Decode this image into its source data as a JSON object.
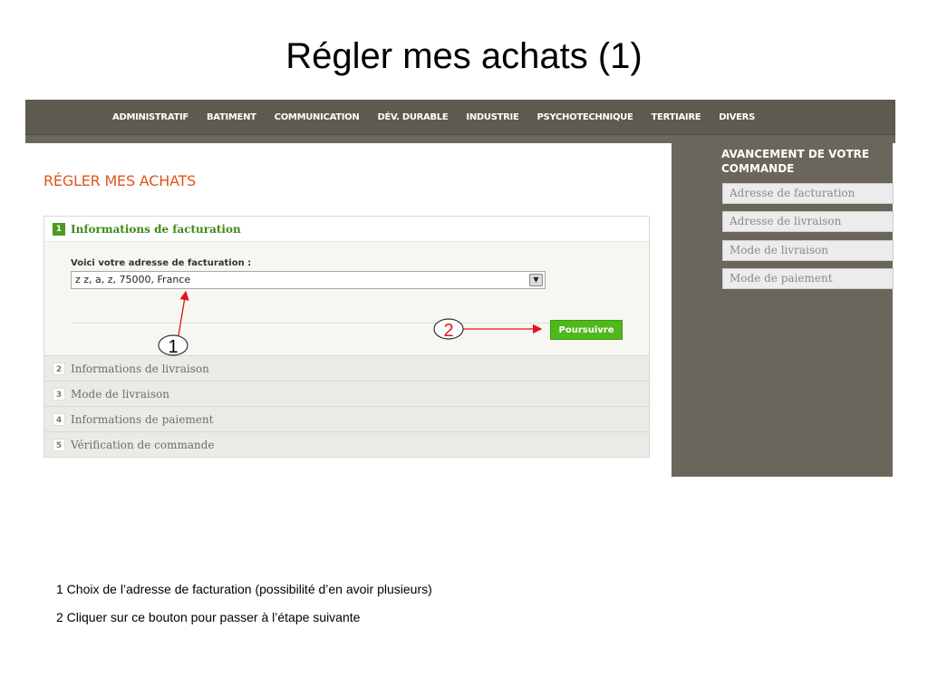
{
  "slide": {
    "title": "Régler mes achats (1)"
  },
  "nav": {
    "items": [
      "ADMINISTRATIF",
      "BATIMENT",
      "COMMUNICATION",
      "DÉV. DURABLE",
      "INDUSTRIE",
      "PSYCHOTECHNIQUE",
      "TERTIAIRE",
      "DIVERS"
    ]
  },
  "page": {
    "heading": "RÉGLER MES ACHATS"
  },
  "checkout": {
    "active_step": {
      "number": "1",
      "label": "Informations de facturation",
      "billing_label": "Voici votre adresse de facturation :",
      "billing_value": "z z, a, z, 75000, France",
      "continue_label": "Poursuivre"
    },
    "steps": [
      {
        "number": "2",
        "label": "Informations de livraison"
      },
      {
        "number": "3",
        "label": "Mode de livraison"
      },
      {
        "number": "4",
        "label": "Informations de paiement"
      },
      {
        "number": "5",
        "label": "Vérification de commande"
      }
    ]
  },
  "sidebar": {
    "title_line1": "AVANCEMENT DE VOTRE",
    "title_line2": "COMMANDE",
    "items": [
      "Adresse de facturation",
      "Adresse de livraison",
      "Mode de livraison",
      "Mode de paiement"
    ]
  },
  "annotations": {
    "marker1": "1",
    "marker2": "2",
    "color": "#e0161b"
  },
  "footnotes": [
    "1 Choix de l’adresse de facturation (possibilité d’en avoir plusieurs)",
    "2 Cliquer sur ce bouton pour passer à l’étape suivante"
  ]
}
